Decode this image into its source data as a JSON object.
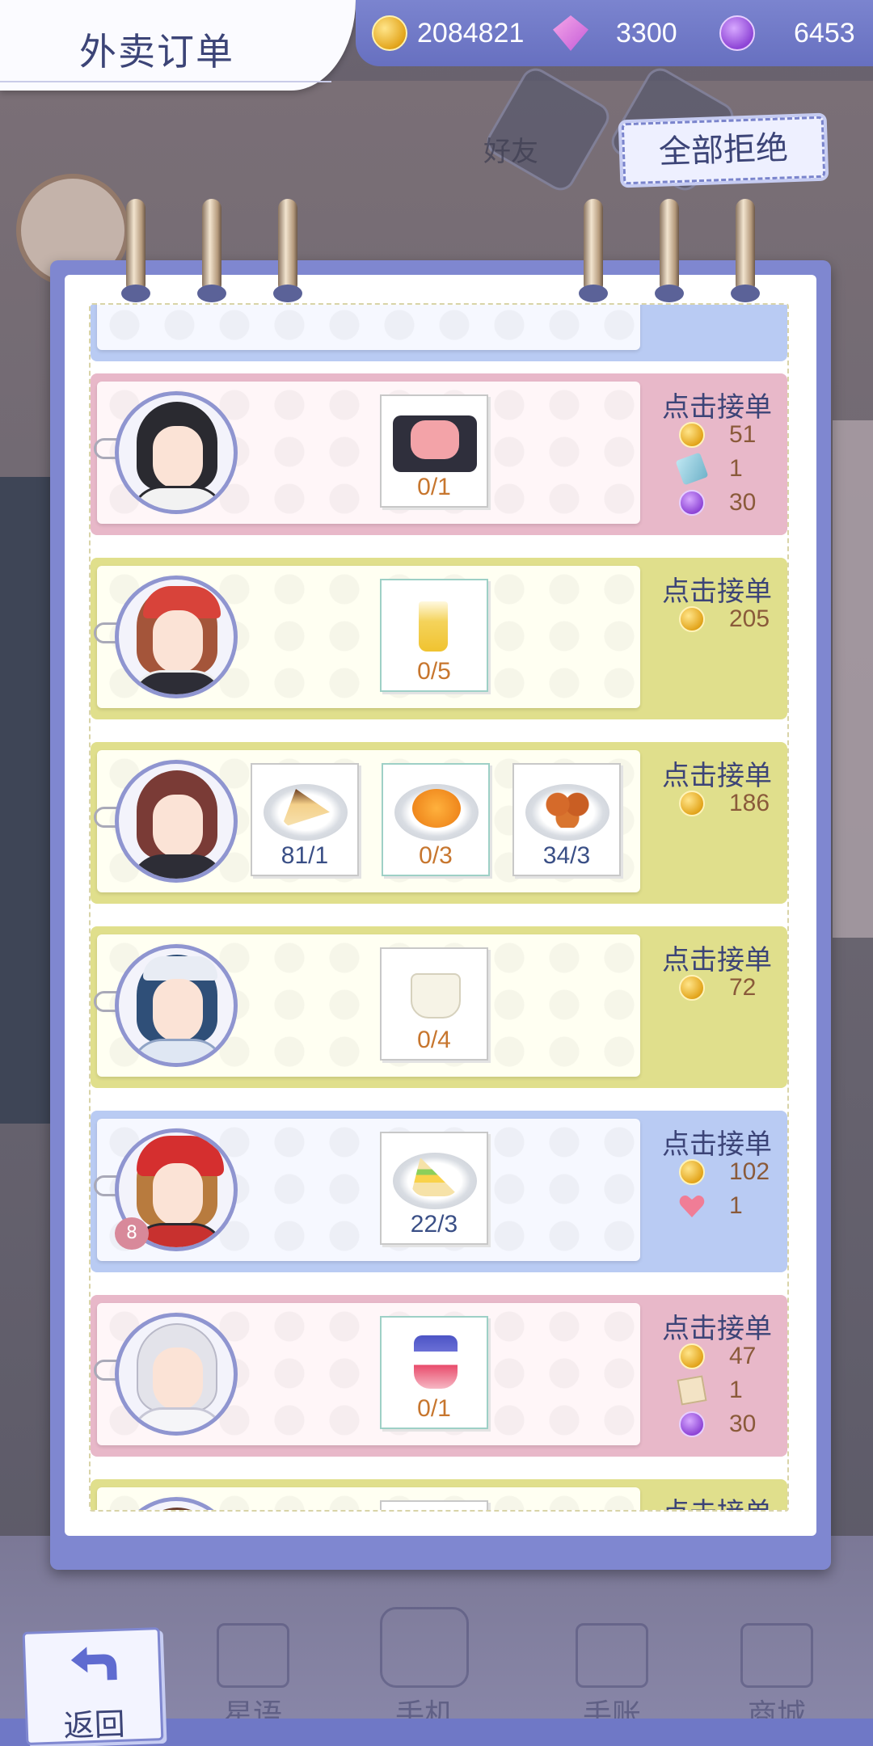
{
  "header": {
    "title": "外卖订单",
    "resources": [
      {
        "icon": "gold-coin-icon",
        "value": "2084821"
      },
      {
        "icon": "pink-diamond-icon",
        "value": "3300"
      },
      {
        "icon": "purple-gem-icon",
        "value": "6453"
      }
    ]
  },
  "refuse_all_label": "全部拒绝",
  "orders": [
    {
      "theme": "pink",
      "customer": "long-black-hair-man",
      "items": [
        {
          "icon": "cake-dessert-icon",
          "count": "0/1",
          "enough": false
        }
      ],
      "accept_label": "点击接单",
      "rewards": [
        {
          "icon": "gold-coin-icon",
          "value": "51"
        },
        {
          "icon": "ticket-icon",
          "value": "1"
        },
        {
          "icon": "purple-gem-icon",
          "value": "30"
        }
      ]
    },
    {
      "theme": "yellow",
      "customer": "red-cap-boy",
      "items": [
        {
          "icon": "juice-glass-icon",
          "count": "0/5",
          "enough": false
        }
      ],
      "accept_label": "点击接单",
      "rewards": [
        {
          "icon": "gold-coin-icon",
          "value": "205"
        }
      ]
    },
    {
      "theme": "yellow",
      "customer": "brown-hair-woman",
      "items": [
        {
          "icon": "cake-slice-icon",
          "count": "81/1",
          "enough": true
        },
        {
          "icon": "orange-jelly-icon",
          "count": "0/3",
          "enough": false
        },
        {
          "icon": "meatball-skewer-icon",
          "count": "34/3",
          "enough": true
        }
      ],
      "accept_label": "点击接单",
      "rewards": [
        {
          "icon": "gold-coin-icon",
          "value": "186"
        }
      ]
    },
    {
      "theme": "yellow",
      "customer": "blue-hair-nurse",
      "items": [
        {
          "icon": "milk-cup-icon",
          "count": "0/4",
          "enough": false
        }
      ],
      "accept_label": "点击接单",
      "rewards": [
        {
          "icon": "gold-coin-icon",
          "value": "72"
        }
      ]
    },
    {
      "theme": "blue",
      "customer": "red-helmet-boy",
      "badge": "8",
      "items": [
        {
          "icon": "sandwich-icon",
          "count": "22/3",
          "enough": true
        }
      ],
      "accept_label": "点击接单",
      "rewards": [
        {
          "icon": "gold-coin-icon",
          "value": "102"
        },
        {
          "icon": "heart-icon",
          "value": "1"
        }
      ]
    },
    {
      "theme": "pink",
      "customer": "white-hair-man",
      "items": [
        {
          "icon": "berry-parfait-icon",
          "count": "0/1",
          "enough": false
        }
      ],
      "accept_label": "点击接单",
      "rewards": [
        {
          "icon": "gold-coin-icon",
          "value": "47"
        },
        {
          "icon": "recipe-card-icon",
          "value": "1"
        },
        {
          "icon": "purple-gem-icon",
          "value": "30"
        }
      ]
    },
    {
      "theme": "yellow",
      "customer": "partial-customer",
      "items": [],
      "accept_label": "点击接单",
      "rewards": []
    }
  ],
  "nav": {
    "back_label": "返回",
    "items": [
      "星语",
      "手机",
      "手账",
      "商城"
    ]
  },
  "background_labels": {
    "friends": "好友"
  },
  "colors": {
    "accent": "#6770c0",
    "title_text": "#3c4477",
    "card_pink": "#e8b8c9",
    "card_yellow": "#e0df8c",
    "card_blue": "#b9cbf3",
    "count_short": "#c7762e",
    "count_ok": "#3a4f86"
  }
}
